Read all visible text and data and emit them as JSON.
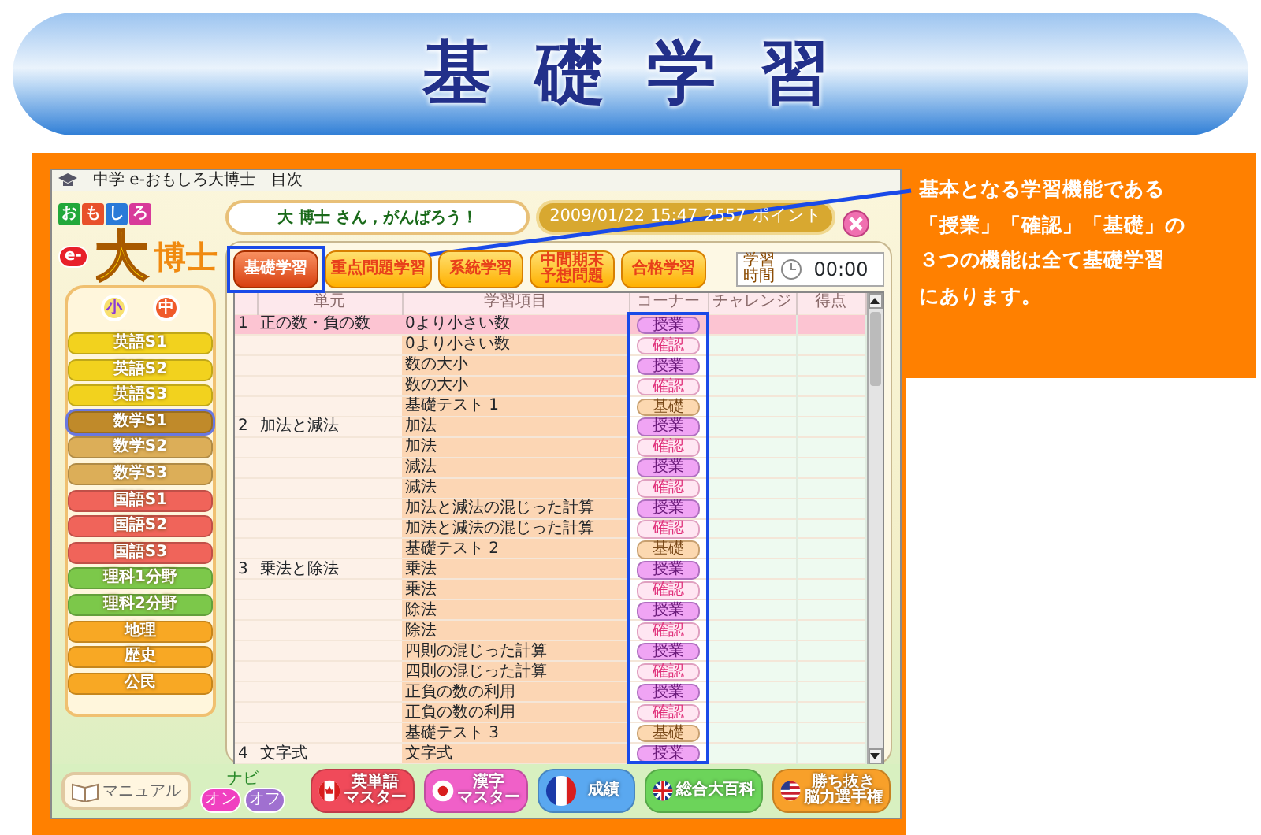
{
  "banner": {
    "title": "基 礎 学 習"
  },
  "note": {
    "lines": [
      "基本となる学習機能である",
      "「授業」「確認」「基礎」の",
      "３つの機能は全て基礎学習",
      "にあります。"
    ]
  },
  "window": {
    "title": "中学 e-おもしろ大博士",
    "menu": "目次"
  },
  "logo": {
    "letters": [
      {
        "char": "お",
        "color": "#22a83a"
      },
      {
        "char": "も",
        "color": "#e8502a"
      },
      {
        "char": "し",
        "color": "#2a7ad8"
      },
      {
        "char": "ろ",
        "color": "#d83a9a"
      }
    ],
    "prefix": "e-",
    "big": "大",
    "rest": "博士"
  },
  "grades": [
    {
      "label": "小",
      "selected": false
    },
    {
      "label": "中",
      "selected": true
    }
  ],
  "subjects": [
    {
      "label": "英語S1",
      "color": "#f2d21e",
      "selected": false
    },
    {
      "label": "英語S2",
      "color": "#f2d21e",
      "selected": false
    },
    {
      "label": "英語S3",
      "color": "#f2d21e",
      "selected": false
    },
    {
      "label": "数学S1",
      "color": "#c08a2a",
      "selected": true
    },
    {
      "label": "数学S2",
      "color": "#dcae58",
      "selected": false
    },
    {
      "label": "数学S3",
      "color": "#dcae58",
      "selected": false
    },
    {
      "label": "国語S1",
      "color": "#f0645a",
      "selected": false
    },
    {
      "label": "国語S2",
      "color": "#f0645a",
      "selected": false
    },
    {
      "label": "国語S3",
      "color": "#f0645a",
      "selected": false
    },
    {
      "label": "理科1分野",
      "color": "#7cc84a",
      "selected": false
    },
    {
      "label": "理科2分野",
      "color": "#7cc84a",
      "selected": false
    },
    {
      "label": "地理",
      "color": "#f8a824",
      "selected": false
    },
    {
      "label": "歴史",
      "color": "#f8a824",
      "selected": false
    },
    {
      "label": "公民",
      "color": "#f8a824",
      "selected": false
    }
  ],
  "greeting": "大 博士 さん，がんばろう！",
  "status": {
    "datetime": "2009/01/22 15:47",
    "points": "2557",
    "points_unit": "ポイント"
  },
  "tabs": [
    {
      "lines": [
        "基礎学習"
      ],
      "selected": true
    },
    {
      "lines": [
        "重点問題学習"
      ],
      "selected": false
    },
    {
      "lines": [
        "系統学習"
      ],
      "selected": false
    },
    {
      "lines": [
        "中間期末",
        "予想問題"
      ],
      "selected": false
    },
    {
      "lines": [
        "合格学習"
      ],
      "selected": false
    }
  ],
  "timer": {
    "lines": [
      "学習",
      "時間"
    ],
    "value": "00:00"
  },
  "table": {
    "columns": [
      "単元",
      "学習項目",
      "コーナー",
      "チャレンジ",
      "得点"
    ],
    "rows": [
      {
        "unit_no": "1",
        "unit": "正の数・負の数",
        "topic": "0より小さい数",
        "corner": "授業",
        "kind": "lesson",
        "selected": true
      },
      {
        "topic": "0より小さい数",
        "corner": "確認",
        "kind": "check",
        "selected": false
      },
      {
        "topic": "数の大小",
        "corner": "授業",
        "kind": "lesson",
        "selected": false
      },
      {
        "topic": "数の大小",
        "corner": "確認",
        "kind": "check",
        "selected": false
      },
      {
        "topic": "基礎テスト 1",
        "corner": "基礎",
        "kind": "basic",
        "selected": false
      },
      {
        "unit_no": "2",
        "unit": "加法と減法",
        "topic": "加法",
        "corner": "授業",
        "kind": "lesson",
        "selected": false
      },
      {
        "topic": "加法",
        "corner": "確認",
        "kind": "check",
        "selected": false
      },
      {
        "topic": "減法",
        "corner": "授業",
        "kind": "lesson",
        "selected": false
      },
      {
        "topic": "減法",
        "corner": "確認",
        "kind": "check",
        "selected": false
      },
      {
        "topic": "加法と減法の混じった計算",
        "corner": "授業",
        "kind": "lesson",
        "selected": false
      },
      {
        "topic": "加法と減法の混じった計算",
        "corner": "確認",
        "kind": "check",
        "selected": false
      },
      {
        "topic": "基礎テスト 2",
        "corner": "基礎",
        "kind": "basic",
        "selected": false
      },
      {
        "unit_no": "3",
        "unit": "乗法と除法",
        "topic": "乗法",
        "corner": "授業",
        "kind": "lesson",
        "selected": false
      },
      {
        "topic": "乗法",
        "corner": "確認",
        "kind": "check",
        "selected": false
      },
      {
        "topic": "除法",
        "corner": "授業",
        "kind": "lesson",
        "selected": false
      },
      {
        "topic": "除法",
        "corner": "確認",
        "kind": "check",
        "selected": false
      },
      {
        "topic": "四則の混じった計算",
        "corner": "授業",
        "kind": "lesson",
        "selected": false
      },
      {
        "topic": "四則の混じった計算",
        "corner": "確認",
        "kind": "check",
        "selected": false
      },
      {
        "topic": "正負の数の利用",
        "corner": "授業",
        "kind": "lesson",
        "selected": false
      },
      {
        "topic": "正負の数の利用",
        "corner": "確認",
        "kind": "check",
        "selected": false
      },
      {
        "topic": "基礎テスト 3",
        "corner": "基礎",
        "kind": "basic",
        "selected": false
      },
      {
        "unit_no": "4",
        "unit": "文字式",
        "topic": "文字式",
        "corner": "授業",
        "kind": "lesson",
        "selected": false
      }
    ]
  },
  "manual": "マニュアル",
  "navi": {
    "label": "ナビ",
    "options": [
      {
        "label": "オン",
        "selected": true
      },
      {
        "label": "オフ",
        "selected": false
      }
    ]
  },
  "tools": [
    {
      "lines": [
        "英単語",
        "マスター"
      ],
      "kind": "canada",
      "color": "#f04a5a"
    },
    {
      "lines": [
        "漢字",
        "マスター"
      ],
      "kind": "japan",
      "color": "#f060c8"
    },
    {
      "lines": [
        "成績"
      ],
      "kind": "france",
      "color": "#5aa8f0"
    },
    {
      "lines": [
        "総合大百科"
      ],
      "kind": "uk",
      "color": "#6cd45a"
    },
    {
      "lines": [
        "勝ち抜き",
        "脳力選手権"
      ],
      "kind": "usa",
      "color": "#f8a02a"
    }
  ]
}
